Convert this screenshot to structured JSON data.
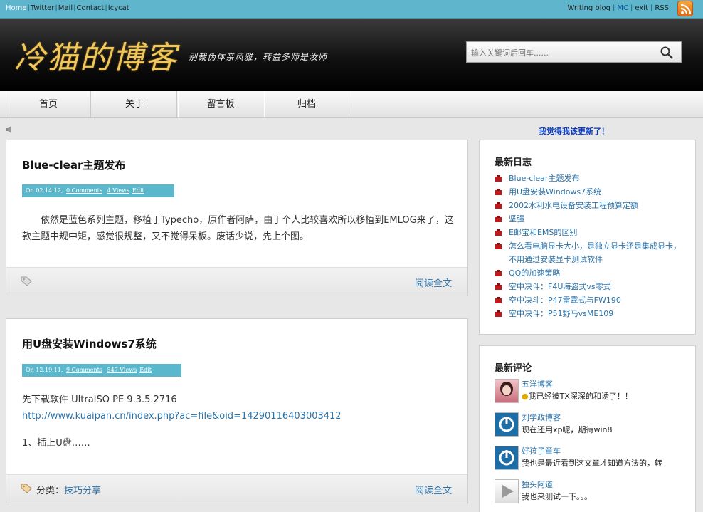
{
  "topbar": {
    "left_links": [
      "Home",
      "Twitter",
      "Mail",
      "Contact",
      "Icycat"
    ],
    "right_links": [
      "Writing blog",
      "MC",
      "exit",
      "RSS"
    ]
  },
  "header": {
    "logo_text": "冷猫的博客",
    "slogan": "别裁伪体亲风雅，转益多师是汝师",
    "search_placeholder": "输入关键词后回车......"
  },
  "nav": [
    "首页",
    "关于",
    "留言板",
    "归档"
  ],
  "announcement": "我觉得我该更新了！",
  "posts": [
    {
      "title": "Blue-clear主题发布",
      "meta_date": "On 02.14.12",
      "meta_comments": "0 Comments",
      "meta_views": "4 Views",
      "meta_edit": "Edit",
      "body": "依然是蓝色系列主题，移植于Typecho，原作者阿萨，由于个人比较喜欢所以移植到EMLOG来了，这款主题中规中矩，感觉很规整，又不觉得呆板。废话少说，先上个图。",
      "read_more": "阅读全文"
    },
    {
      "title": "用U盘安装Windows7系统",
      "meta_date": "On 12.19.11",
      "meta_comments": "9 Comments",
      "meta_views": "547 Views",
      "meta_edit": "Edit",
      "body_line1": "先下载软件 UltraISO PE 9.3.5.2716",
      "body_url": "http://www.kuaipan.cn/index.php?ac=file&oid=14290116403003412",
      "body_line3": "1、插上U盘……",
      "category_label": "分类：",
      "category": "技巧分享",
      "read_more": "阅读全文"
    }
  ],
  "sidebar": {
    "recent_title": "最新日志",
    "recent": [
      "Blue-clear主题发布",
      "用U盘安装Windows7系统",
      "2002水利水电设备安装工程预算定额",
      "坚强",
      "E邮宝和EMS的区别",
      "怎么看电脑显卡大小，是独立显卡还是集成显卡，不用通过安装显卡测试软件",
      "QQ的加速策略",
      "空中决斗：F4U海盗式vs零式",
      "空中决斗：P47雷霆式与FW190",
      "空中决斗：P51野马vsME109"
    ],
    "comments_title": "最新评论",
    "comments": [
      {
        "author": "五洋博客",
        "text": "我已经被TX深深的和诱了！！"
      },
      {
        "author": "刘学政博客",
        "text": "现在还用xp呢，期待win8"
      },
      {
        "author": "好孩子童车",
        "text": "我也是最近看到这文章才知道方法的，转"
      },
      {
        "author": "独头阿道",
        "text": "我也来测试一下。。。"
      }
    ]
  },
  "colors": {
    "topbar": "#5fb5cb",
    "meta_bar": "#5bb7cc",
    "link": "#2a72a8",
    "logo": "#f1c65a",
    "announce": "#0a3dbd"
  }
}
